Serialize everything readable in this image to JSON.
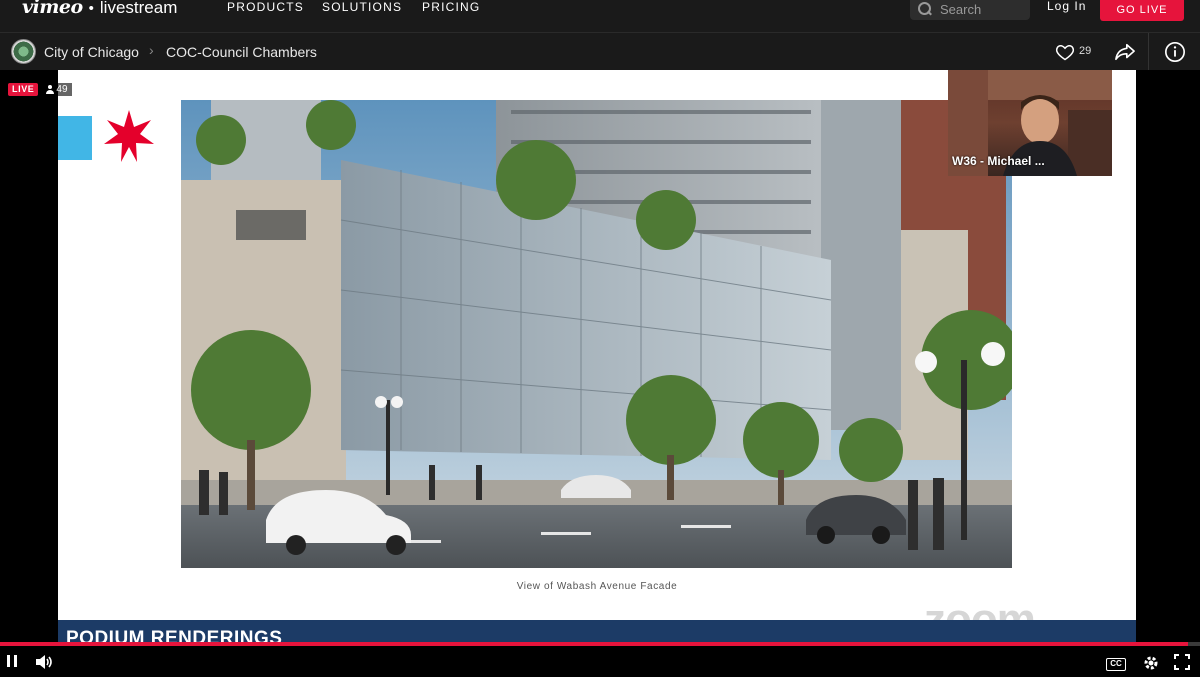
{
  "nav": {
    "logo_brand": "vimeo",
    "logo_separator": "•",
    "logo_product": "livestream",
    "items": [
      {
        "label": "PRODUCTS"
      },
      {
        "label": "SOLUTIONS"
      },
      {
        "label": "PRICING"
      }
    ],
    "search_placeholder": "Search",
    "login_label": "Log In",
    "golive_label": "GO LIVE"
  },
  "breadcrumb": {
    "channel": "City of Chicago",
    "separator": "›",
    "event": "COC-Council Chambers",
    "likes": "29"
  },
  "player": {
    "live_label": "LIVE",
    "viewer_count": "49",
    "pip_name": "W36 - Michael ...",
    "progress_fraction": 0.99
  },
  "slide": {
    "caption": "View of  Wabash Avenue Facade",
    "banner_title": "PODIUM RENDERINGS",
    "watermark": "zoom"
  },
  "colors": {
    "accent": "#e6143c",
    "flag_blue": "#41b6e6",
    "flag_red": "#e4002b",
    "banner": "#1c3b66"
  },
  "icons": [
    "search-icon",
    "heart-icon",
    "share-icon",
    "info-icon",
    "pause-icon",
    "volume-icon",
    "closed-captions-icon",
    "settings-icon",
    "fullscreen-icon",
    "chevron-right-icon"
  ]
}
